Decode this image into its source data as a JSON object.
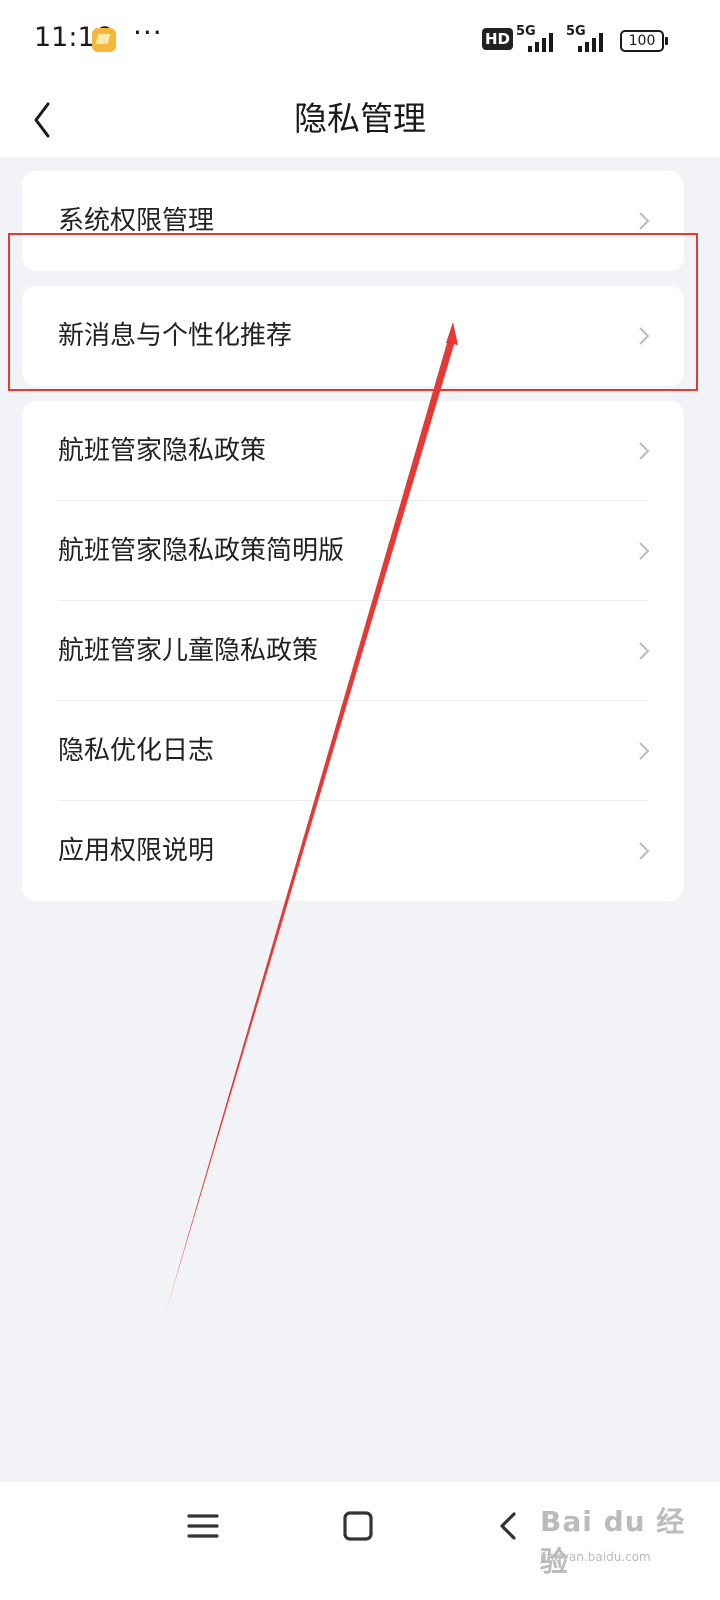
{
  "status_bar": {
    "time": "11:16",
    "more": "···",
    "hd": "HD",
    "signal_1_label": "5G",
    "signal_2_label": "5G",
    "battery": "100"
  },
  "header": {
    "title": "隐私管理",
    "back_icon": "chevron-left-icon"
  },
  "groups": [
    {
      "items": [
        {
          "label": "系统权限管理"
        }
      ]
    },
    {
      "items": [
        {
          "label": "新消息与个性化推荐"
        }
      ]
    },
    {
      "items": [
        {
          "label": "航班管家隐私政策"
        },
        {
          "label": "航班管家隐私政策简明版"
        },
        {
          "label": "航班管家儿童隐私政策"
        },
        {
          "label": "隐私优化日志"
        },
        {
          "label": "应用权限说明"
        }
      ]
    }
  ],
  "annotation": {
    "color": "#e53935"
  },
  "system_nav": {
    "icons": [
      "menu-icon",
      "home-icon",
      "back-icon"
    ]
  },
  "watermark": {
    "main": "Bai du 经验",
    "sub": "jingyan.baidu.com"
  }
}
